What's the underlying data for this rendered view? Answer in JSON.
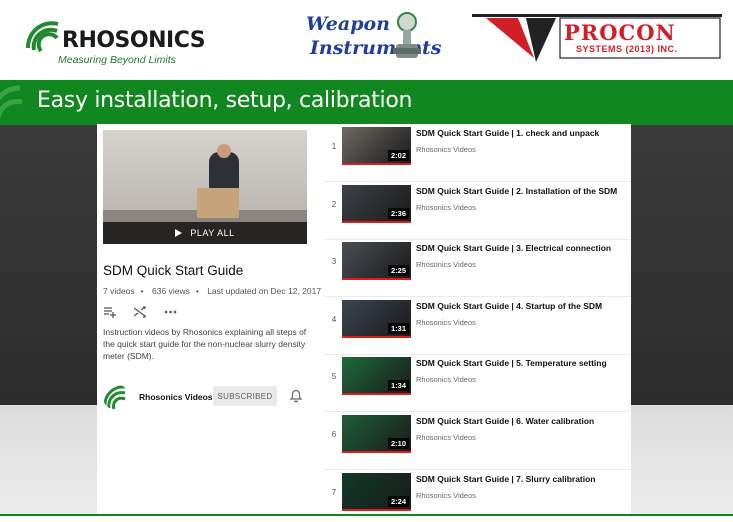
{
  "logos": {
    "rhosonics_name": "RHOSONICS",
    "rhosonics_tagline": "Measuring Beyond Limits",
    "weapon_line1": "Weapon",
    "weapon_line2": "Instruments",
    "procon_name": "PROCON",
    "procon_sub": "SYSTEMS (2013) INC."
  },
  "banner": {
    "title": "Easy installation, setup, calibration"
  },
  "playlist": {
    "play_all": "PLAY ALL",
    "title": "SDM Quick Start Guide",
    "videos_count": "7 videos",
    "views": "636 views",
    "updated": "Last updated on Dec 12, 2017",
    "description": "Instruction videos by Rhosonics explaining all steps of the quick start guide for the non-nuclear slurry density meter (SDM).",
    "owner": "Rhosonics Videos",
    "subscribe_label": "SUBSCRIBED"
  },
  "videos": [
    {
      "index": "1",
      "title": "SDM Quick Start Guide | 1. check and unpack",
      "channel": "Rhosonics Videos",
      "duration": "2:02",
      "thumb": "#6e6a64"
    },
    {
      "index": "2",
      "title": "SDM Quick Start Guide | 2. Installation of the SDM",
      "channel": "Rhosonics Videos",
      "duration": "2:36",
      "thumb": "#3d4248"
    },
    {
      "index": "3",
      "title": "SDM Quick Start Guide | 3. Electrical connection",
      "channel": "Rhosonics Videos",
      "duration": "2:25",
      "thumb": "#4a4f55"
    },
    {
      "index": "4",
      "title": "SDM Quick Start Guide | 4. Startup of the SDM",
      "channel": "Rhosonics Videos",
      "duration": "1:31",
      "thumb": "#3b4652"
    },
    {
      "index": "5",
      "title": "SDM Quick Start Guide | 5. Temperature setting",
      "channel": "Rhosonics Videos",
      "duration": "1:34",
      "thumb": "#1f6b3c"
    },
    {
      "index": "6",
      "title": "SDM Quick Start Guide | 6. Water calibration",
      "channel": "Rhosonics Videos",
      "duration": "2:10",
      "thumb": "#1e5f38"
    },
    {
      "index": "7",
      "title": "SDM Quick Start Guide | 7. Slurry calibration",
      "channel": "Rhosonics Videos",
      "duration": "2:24",
      "thumb": "#123a28"
    }
  ],
  "colors": {
    "brand_green": "#11871f",
    "progress_red": "#e01b1b",
    "procon_red": "#d21f26"
  }
}
